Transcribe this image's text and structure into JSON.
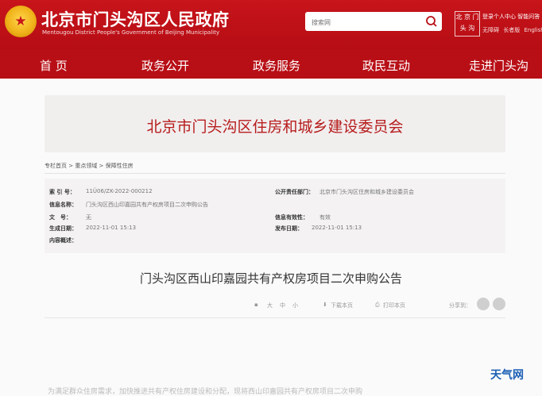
{
  "header": {
    "emblem_glyph": "★",
    "title_cn": "北京市门头沟区人民政府",
    "title_en": "Mentougou District People's Government of Beijing Municipality",
    "search_placeholder": "搜索网",
    "logo_text": "北 京 门 头 沟",
    "login_text": "登录个人中心 智能问答",
    "utils": [
      "无障碍",
      "长者版",
      "English"
    ]
  },
  "nav": {
    "items": [
      "首 页",
      "政务公开",
      "政务服务",
      "政民互动",
      "走进门头沟"
    ]
  },
  "page": {
    "dept_title": "北京市门头沟区住房和城乡建设委员会",
    "breadcrumb": "专栏首页 > 重点领域 > 保障性住房",
    "meta": {
      "index_label": "索 引 号：",
      "index_value": "11Ü06/ZK-2022-000212",
      "publisher_label": "公开责任部门：",
      "publisher_value": "北京市门头沟区住房和城乡建设委员会",
      "info_name_label": "信息名称：",
      "info_name_value": "门头沟区西山印嘉园共有产权房项目二次申购公告",
      "doc_no_label": "文　号：",
      "doc_no_value": "无",
      "validity_label": "信息有效性：",
      "validity_value": "有效",
      "gen_date_label": "生成日期：",
      "gen_date_value": "2022-11-01 15:13",
      "pub_date_label": "发布日期：",
      "pub_date_value": "2022-11-01 15:13",
      "summary_label": "内容概述："
    },
    "article_title": "门头沟区西山印嘉园共有产权房项目二次申购公告",
    "tools": {
      "font_large": "大",
      "font_mid": "中",
      "font_small": "小",
      "download": "下载本页",
      "print": "打印本页",
      "share": "分享到："
    },
    "bottom_text": "为满足群众住房需求，加快推进共有产权住房建设和分配，现将西山印嘉园共有产权房项目二次申购"
  },
  "watermark": "天气网",
  "colors": {
    "brand_red": "#c8141b",
    "nav_red": "#b80f16",
    "dept_red": "#b71c1c"
  }
}
